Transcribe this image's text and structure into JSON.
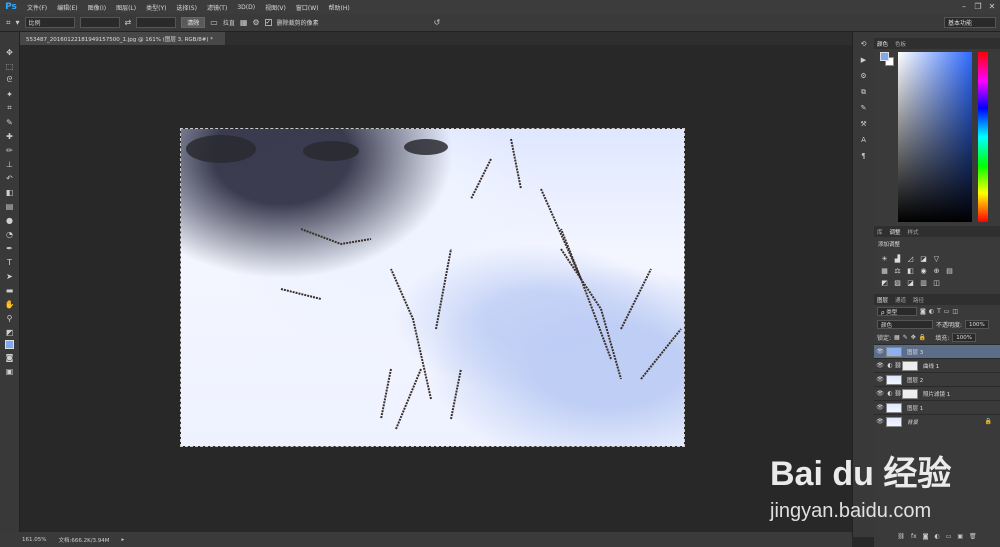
{
  "app": {
    "logo": "Ps"
  },
  "menu": [
    "文件(F)",
    "编辑(E)",
    "图像(I)",
    "图层(L)",
    "类型(Y)",
    "选择(S)",
    "滤镜(T)",
    "3D(D)",
    "视图(V)",
    "窗口(W)",
    "帮助(H)"
  ],
  "window_controls": {
    "minimize": "–",
    "restore": "❐",
    "close": "✕"
  },
  "options": {
    "ratio_select": "比例",
    "clear_button": "清除",
    "straighten_label": "拉直",
    "delete_crop_label": "删除裁剪的像素",
    "workspace": "基本功能"
  },
  "document": {
    "tab_title": "553487_20160122181949157500_1.jpg @ 161% (图层 3, RGB/8#) *"
  },
  "status": {
    "zoom": "161.05%",
    "doc_size": "文档:666.2K/3.94M"
  },
  "color_panel": {
    "tabs": [
      "颜色",
      "色板"
    ],
    "foreground": "#7fa8f0",
    "background": "#ffffff"
  },
  "adjust_panel": {
    "tabs": [
      "库",
      "调整",
      "样式"
    ],
    "title": "添加调整"
  },
  "layer_panel": {
    "tabs": [
      "图层",
      "通道",
      "路径"
    ],
    "kind_select": "ρ 类型",
    "blend_mode": "颜色",
    "opacity_label": "不透明度:",
    "opacity": "100%",
    "lock_label": "锁定:",
    "fill_label": "填充:",
    "fill": "100%",
    "layers": [
      {
        "name": "图层 3",
        "active": true,
        "adjust": false
      },
      {
        "name": "曲线 1",
        "active": false,
        "adjust": true
      },
      {
        "name": "图层 2",
        "active": false,
        "adjust": false
      },
      {
        "name": "照片滤镜 1",
        "active": false,
        "adjust": true
      },
      {
        "name": "图层 1",
        "active": false,
        "adjust": false
      },
      {
        "name": "背景",
        "active": false,
        "adjust": false
      }
    ]
  },
  "watermark": {
    "brand": "Bai du 经验",
    "url": "jingyan.baidu.com"
  }
}
